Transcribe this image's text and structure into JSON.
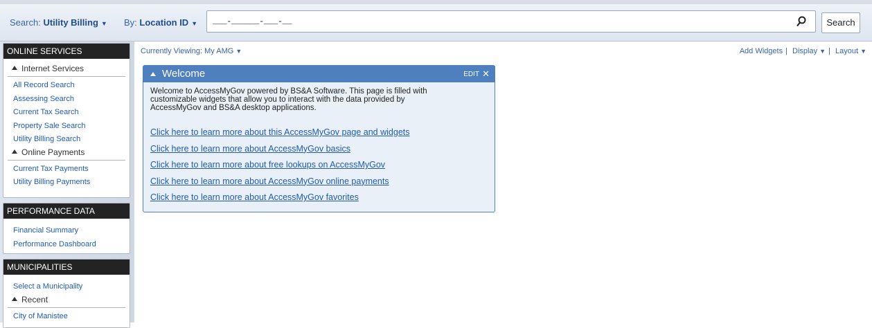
{
  "search": {
    "search_label": "Search:",
    "search_value": "Utility Billing",
    "by_label": "By:",
    "by_value": "Location ID",
    "input_value": "___-______-___-__",
    "button_label": "Search",
    "search_icon": "search-icon"
  },
  "sidebar": {
    "online_services": {
      "title": "ONLINE SERVICES",
      "internet_services": {
        "label": "Internet Services",
        "links": [
          "All Record Search",
          "Assessing Search",
          "Current Tax Search",
          "Property Sale Search",
          "Utility Billing Search"
        ]
      },
      "online_payments": {
        "label": "Online Payments",
        "links": [
          "Current Tax Payments",
          "Utility Billing Payments"
        ]
      }
    },
    "performance_data": {
      "title": "PERFORMANCE DATA",
      "links": [
        "Financial Summary",
        "Performance Dashboard"
      ]
    },
    "municipalities": {
      "title": "MUNICIPALITIES",
      "select_label": "Select a Municipality",
      "recent": {
        "label": "Recent",
        "links": [
          "City of Manistee"
        ]
      }
    }
  },
  "main": {
    "currently_viewing_label": "Currently Viewing:",
    "currently_viewing_value": "My AMG",
    "add_widgets": "Add Widgets",
    "display": "Display",
    "layout": "Layout",
    "welcome": {
      "title": "Welcome",
      "edit_label": "EDIT",
      "close_glyph": "✕",
      "intro": "Welcome to AccessMyGov powered by BS&A Software. This page is filled with customizable widgets that allow you to interact with the data provided by AccessMyGov and BS&A desktop applications.",
      "links": [
        "Click here to learn more about this AccessMyGov page and widgets",
        "Click here to learn more about AccessMyGov basics",
        "Click here to learn more about free lookups on AccessMyGov",
        "Click here to learn more about AccessMyGov online payments",
        "Click here to learn more about AccessMyGov favorites"
      ]
    }
  },
  "colors": {
    "accent_blue": "#4e7fbf",
    "link_blue": "#1f5bb3",
    "panel_header": "#232323"
  }
}
